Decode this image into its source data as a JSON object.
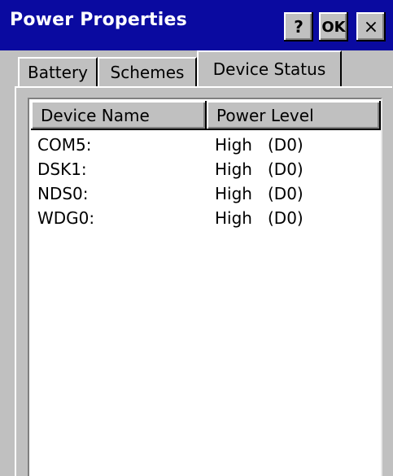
{
  "window": {
    "title": "Power Properties",
    "help_label": "?",
    "ok_label": "OK",
    "close_label": "×"
  },
  "tabs": [
    {
      "label": "Battery",
      "active": false
    },
    {
      "label": "Schemes",
      "active": false
    },
    {
      "label": "Device Status",
      "active": true
    }
  ],
  "list": {
    "columns": [
      "Device Name",
      "Power Level"
    ],
    "rows": [
      {
        "name": "COM5:",
        "level": "High",
        "state": "(D0)"
      },
      {
        "name": "DSK1:",
        "level": "High",
        "state": "(D0)"
      },
      {
        "name": "NDS0:",
        "level": "High",
        "state": "(D0)"
      },
      {
        "name": "WDG0:",
        "level": "High",
        "state": "(D0)"
      }
    ]
  },
  "colors": {
    "titlebar": "#0a0aa0",
    "face": "#c0c0c0",
    "list_bg": "#ffffff"
  }
}
